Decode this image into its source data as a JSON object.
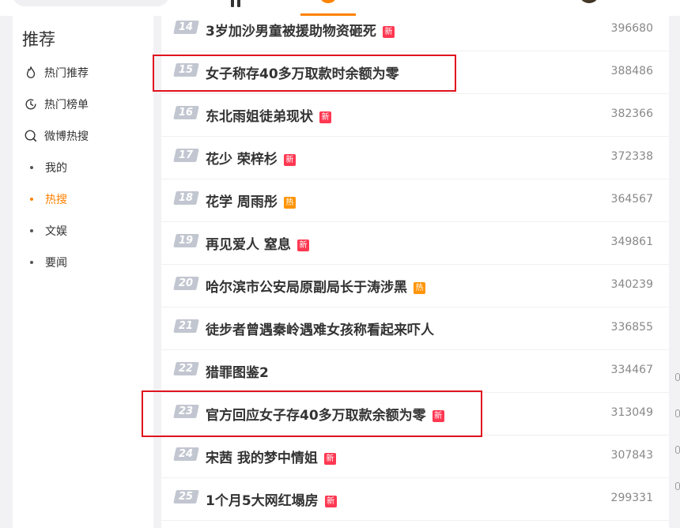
{
  "sidebar": {
    "title": "推荐",
    "items": [
      {
        "label": "热门推荐",
        "icon": "flame-icon"
      },
      {
        "label": "热门榜单",
        "icon": "clock-icon"
      },
      {
        "label": "微博热搜",
        "icon": "search-icon"
      }
    ],
    "subitems": [
      {
        "label": "我的"
      },
      {
        "label": "热搜",
        "active": true
      },
      {
        "label": "文娱"
      },
      {
        "label": "要闻"
      }
    ]
  },
  "hot_list": [
    {
      "rank": "14",
      "title": "3岁加沙男童被援助物资砸死",
      "badge": "新",
      "count": "396680"
    },
    {
      "rank": "15",
      "title": "女子称存40多万取款时余额为零",
      "badge": "",
      "count": "388486"
    },
    {
      "rank": "16",
      "title": "东北雨姐徒弟现状",
      "badge": "新",
      "count": "382366"
    },
    {
      "rank": "17",
      "title": "花少 荣梓杉",
      "badge": "新",
      "count": "372338"
    },
    {
      "rank": "18",
      "title": "花学 周雨彤",
      "badge": "热",
      "count": "364567"
    },
    {
      "rank": "19",
      "title": "再见爱人 窒息",
      "badge": "新",
      "count": "349861"
    },
    {
      "rank": "20",
      "title": "哈尔滨市公安局原副局长于涛涉黑",
      "badge": "热",
      "count": "340239"
    },
    {
      "rank": "21",
      "title": "徒步者曾遇秦岭遇难女孩称看起来吓人",
      "badge": "",
      "count": "336855"
    },
    {
      "rank": "22",
      "title": "猎罪图鉴2",
      "badge": "",
      "count": "334467"
    },
    {
      "rank": "23",
      "title": "官方回应女子存40多万取款余额为零",
      "badge": "新",
      "count": "313049"
    },
    {
      "rank": "24",
      "title": "宋茜 我的梦中情姐",
      "badge": "新",
      "count": "307843"
    },
    {
      "rank": "25",
      "title": "1个月5大网红塌房",
      "badge": "新",
      "count": "299331"
    }
  ],
  "colors": {
    "accent": "#ff8200",
    "badge_new": "#ff3852",
    "badge_hot": "#ff9406",
    "highlight": "#e0141e"
  }
}
